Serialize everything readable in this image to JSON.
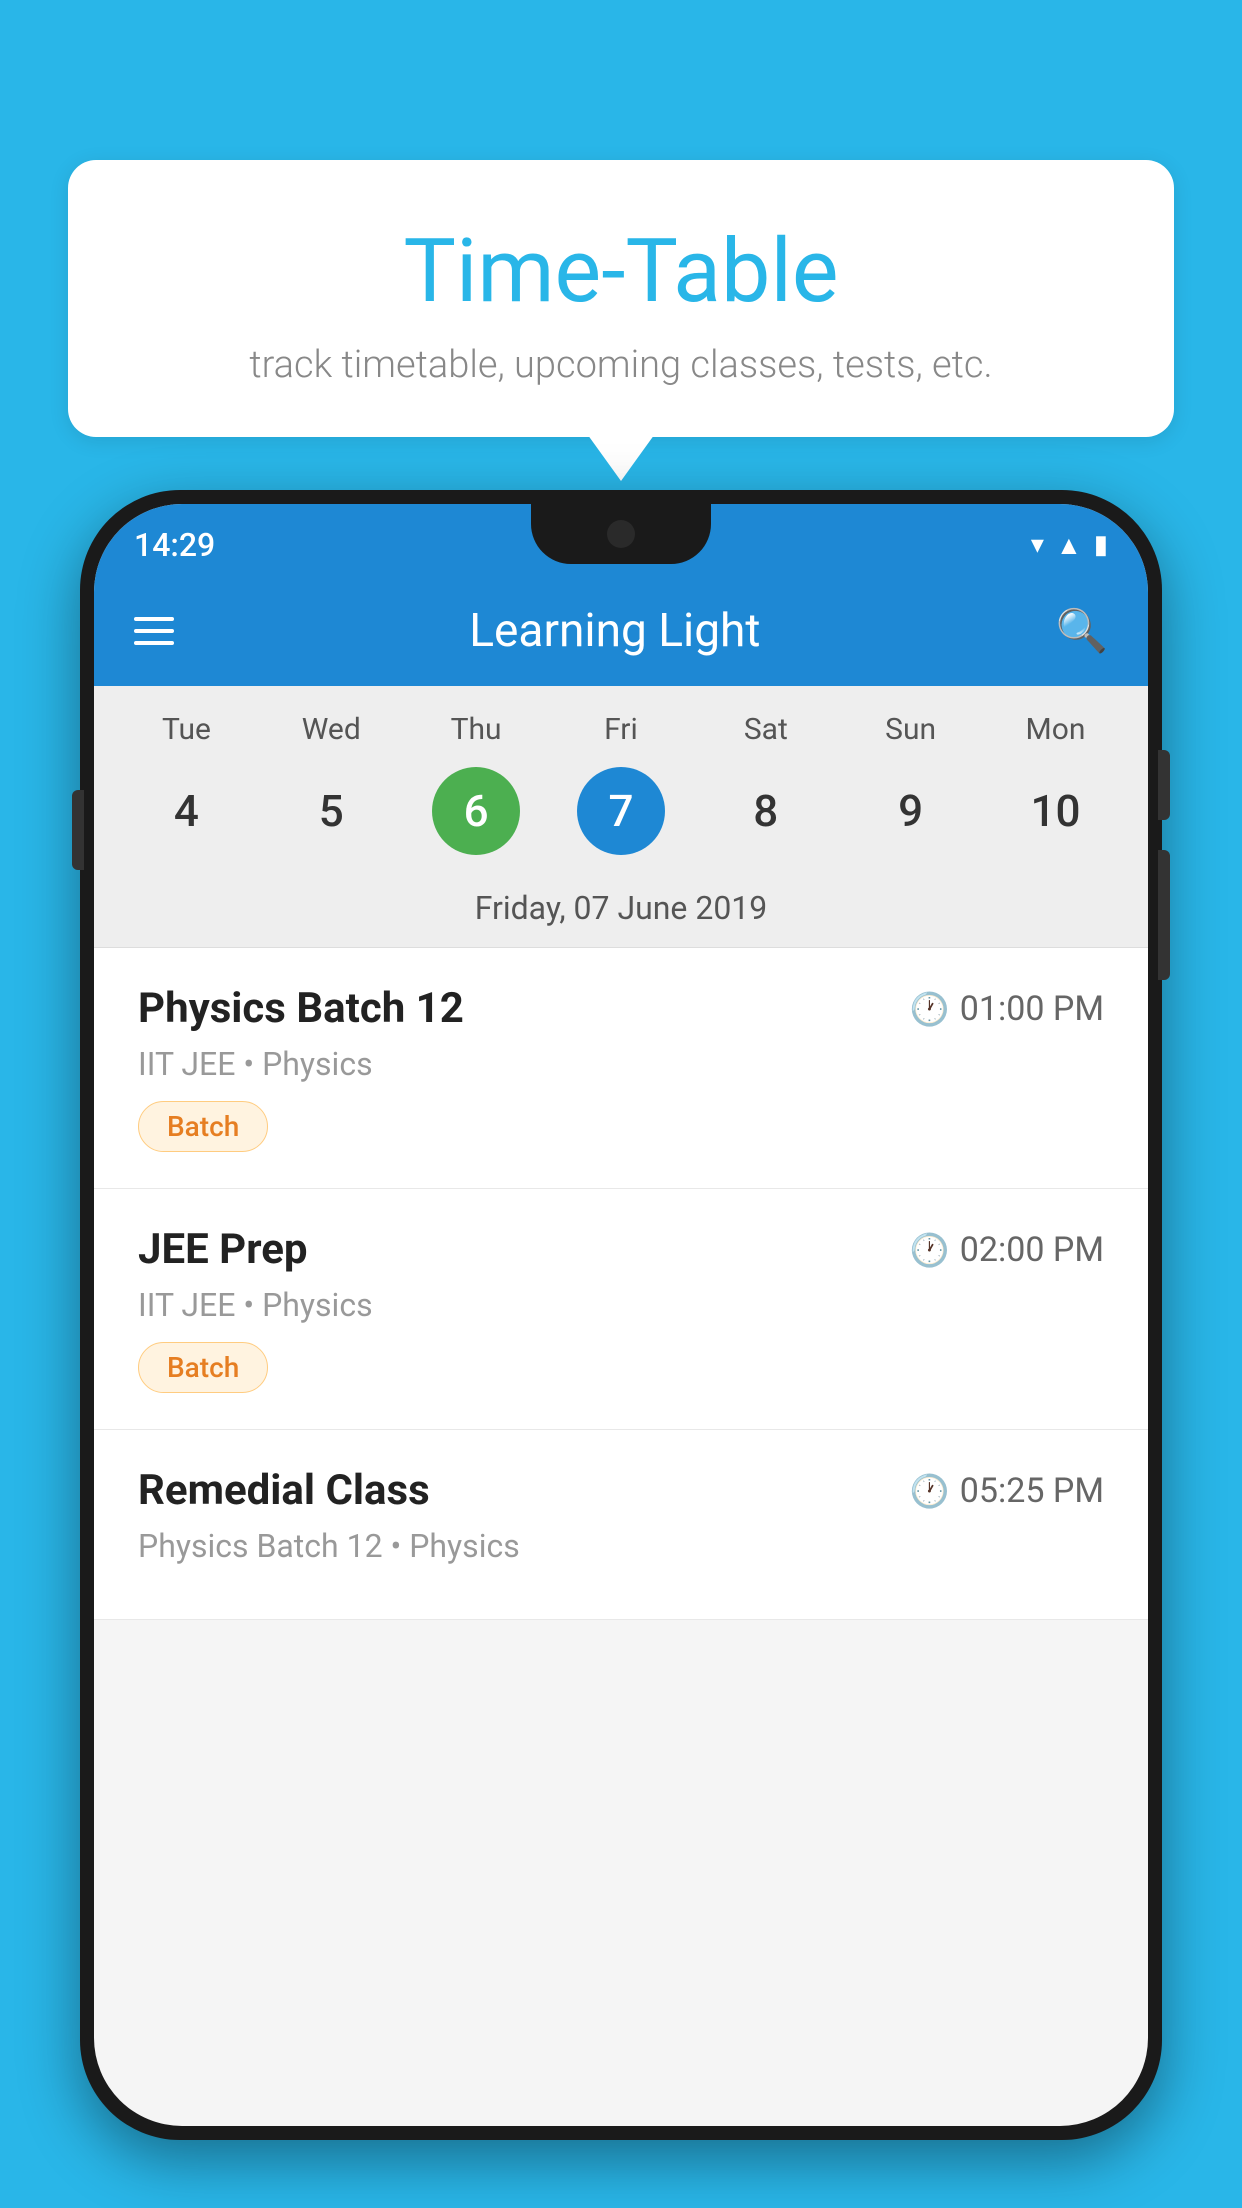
{
  "background": {
    "color": "#29b6e8"
  },
  "tooltip": {
    "title": "Time-Table",
    "subtitle": "track timetable, upcoming classes, tests, etc."
  },
  "phone": {
    "statusBar": {
      "time": "14:29"
    },
    "appBar": {
      "title": "Learning Light"
    },
    "calendar": {
      "days": [
        {
          "label": "Tue",
          "number": "4"
        },
        {
          "label": "Wed",
          "number": "5"
        },
        {
          "label": "Thu",
          "number": "6",
          "state": "today"
        },
        {
          "label": "Fri",
          "number": "7",
          "state": "selected"
        },
        {
          "label": "Sat",
          "number": "8"
        },
        {
          "label": "Sun",
          "number": "9"
        },
        {
          "label": "Mon",
          "number": "10"
        }
      ],
      "selectedDate": "Friday, 07 June 2019"
    },
    "classes": [
      {
        "name": "Physics Batch 12",
        "time": "01:00 PM",
        "meta": "IIT JEE • Physics",
        "badge": "Batch"
      },
      {
        "name": "JEE Prep",
        "time": "02:00 PM",
        "meta": "IIT JEE • Physics",
        "badge": "Batch"
      },
      {
        "name": "Remedial Class",
        "time": "05:25 PM",
        "meta": "Physics Batch 12 • Physics",
        "badge": null
      }
    ]
  }
}
